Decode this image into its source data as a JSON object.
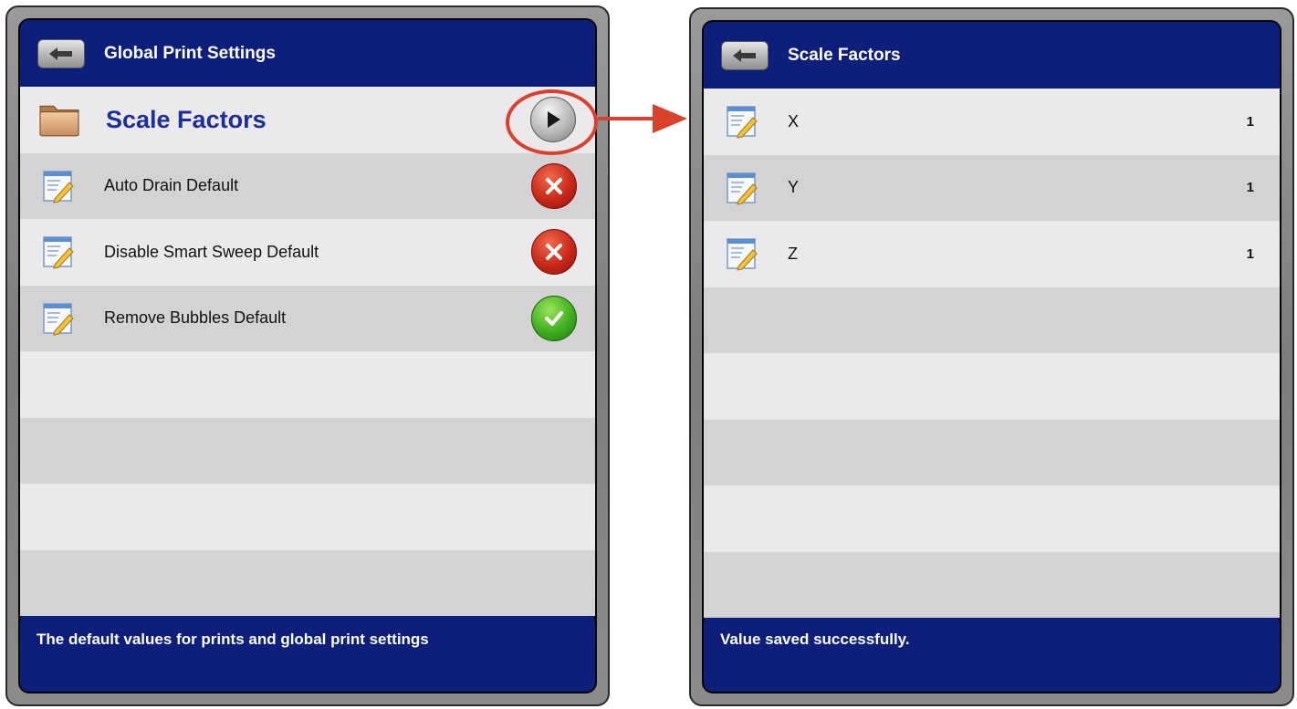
{
  "left_panel": {
    "title": "Global Print Settings",
    "folder": {
      "label": "Scale Factors"
    },
    "items": [
      {
        "label": "Auto Drain Default",
        "state": "off",
        "icon": "close-icon"
      },
      {
        "label": "Disable Smart Sweep Default",
        "state": "off",
        "icon": "close-icon"
      },
      {
        "label": "Remove Bubbles Default",
        "state": "on",
        "icon": "check-icon"
      }
    ],
    "footer": "The default values for prints and global print settings"
  },
  "right_panel": {
    "title": "Scale Factors",
    "items": [
      {
        "label": "X",
        "value": "1"
      },
      {
        "label": "Y",
        "value": "1"
      },
      {
        "label": "Z",
        "value": "1"
      }
    ],
    "footer": "Value saved successfully."
  },
  "colors": {
    "header_blue": "#0d1f7a",
    "row_light": "#ebe9eb",
    "row_dark": "#d4d2d4",
    "highlight_red": "#d9412c",
    "title_blue": "#1b2f9a",
    "toggle_off_red": "#c8281a",
    "toggle_on_green": "#3fae1f"
  }
}
